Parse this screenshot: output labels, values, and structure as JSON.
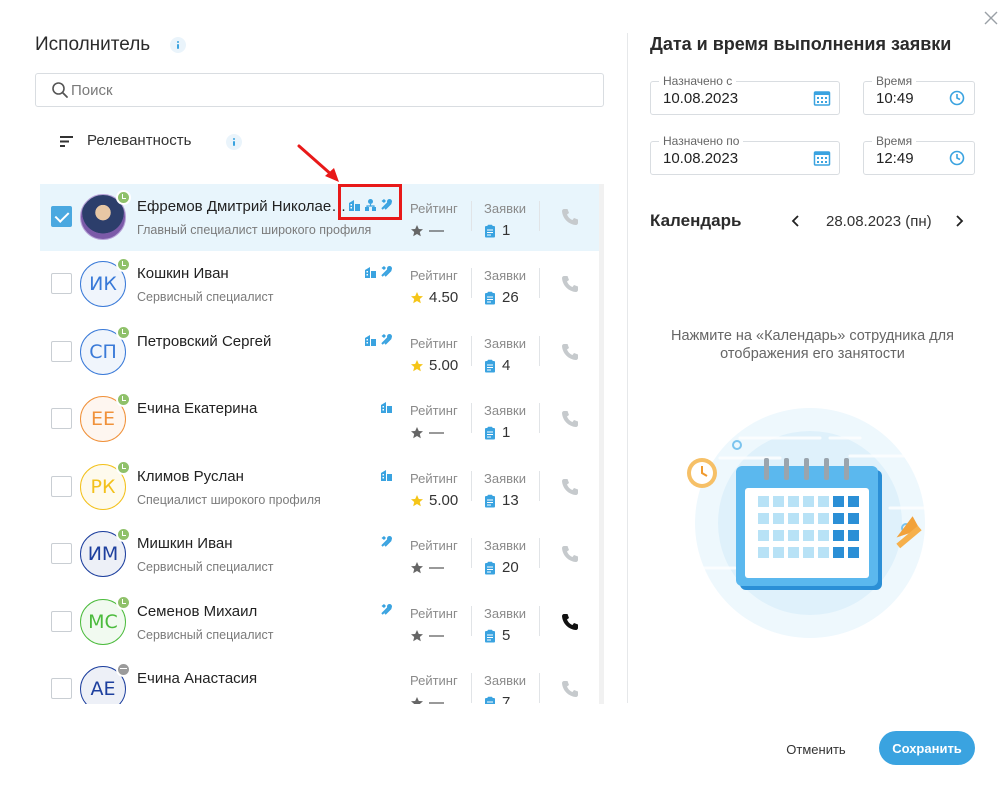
{
  "executor": {
    "title": "Исполнитель",
    "search_placeholder": "Поиск",
    "sort_label": "Релевантность",
    "rating_header": "Рейтинг",
    "orders_header": "Заявки",
    "people": [
      {
        "name": "Ефремов Дмитрий Николае…",
        "role": "Главный специалист широкого профиля",
        "initials": "",
        "photo": true,
        "avatar_color": "#7b5aa8",
        "status": "online",
        "selected": true,
        "skills": [
          "building-icon",
          "org-icon",
          "tools-icon"
        ],
        "rating": "—",
        "rated": false,
        "orders": "1",
        "phone_active": false
      },
      {
        "name": "Кошкин Иван",
        "role": "Сервисный специалист",
        "initials": "ИК",
        "photo": false,
        "avatar_color": "#3a7ad8",
        "status": "online",
        "selected": false,
        "skills": [
          "building-icon",
          "tools-icon"
        ],
        "rating": "4.50",
        "rated": true,
        "orders": "26",
        "phone_active": false
      },
      {
        "name": "Петровский Сергей",
        "role": "",
        "initials": "СП",
        "photo": false,
        "avatar_color": "#3a7ad8",
        "status": "online",
        "selected": false,
        "skills": [
          "building-icon",
          "tools-icon"
        ],
        "rating": "5.00",
        "rated": true,
        "orders": "4",
        "phone_active": false
      },
      {
        "name": "Ечина Екатерина",
        "role": "",
        "initials": "ЕЕ",
        "photo": false,
        "avatar_color": "#f0913a",
        "status": "online",
        "selected": false,
        "skills": [
          "building-icon"
        ],
        "rating": "—",
        "rated": false,
        "orders": "1",
        "phone_active": false
      },
      {
        "name": "Климов Руслан",
        "role": "Специалист широкого профиля",
        "initials": "РК",
        "photo": false,
        "avatar_color": "#f3c11c",
        "status": "online",
        "selected": false,
        "skills": [
          "building-icon"
        ],
        "rating": "5.00",
        "rated": true,
        "orders": "13",
        "phone_active": false
      },
      {
        "name": "Мишкин Иван",
        "role": "Сервисный специалист",
        "initials": "ИМ",
        "photo": false,
        "avatar_color": "#1d3f9e",
        "status": "online",
        "selected": false,
        "skills": [
          "tools-icon"
        ],
        "rating": "—",
        "rated": false,
        "orders": "20",
        "phone_active": false
      },
      {
        "name": "Семенов Михаил",
        "role": "Сервисный специалист",
        "initials": "МС",
        "photo": false,
        "avatar_color": "#4bbb3c",
        "status": "online",
        "selected": false,
        "skills": [
          "tools-icon"
        ],
        "rating": "—",
        "rated": false,
        "orders": "5",
        "phone_active": true
      },
      {
        "name": "Ечина Анастасия",
        "role": "",
        "initials": "АЕ",
        "photo": false,
        "avatar_color": "#1d3f9e",
        "status": "offline",
        "selected": false,
        "skills": [],
        "rating": "—",
        "rated": false,
        "orders": "7",
        "phone_active": false
      }
    ]
  },
  "schedule": {
    "title": "Дата и время выполнения заявки",
    "from_label": "Назначено с",
    "from_value": "10.08.2023",
    "from_time_label": "Время",
    "from_time_value": "10:49",
    "to_label": "Назначено по",
    "to_value": "10.08.2023",
    "to_time_label": "Время",
    "to_time_value": "12:49",
    "calendar_title": "Календарь",
    "calendar_date": "28.08.2023 (пн)",
    "hint": "Нажмите на «Календарь» сотрудника для отображения его занятости"
  },
  "footer": {
    "cancel_label": "Отменить",
    "save_label": "Сохранить"
  },
  "colors": {
    "accent": "#3aa3e0",
    "selected_row": "#e8f5fc",
    "annotation": "#e81919",
    "star": "#f5c518"
  }
}
